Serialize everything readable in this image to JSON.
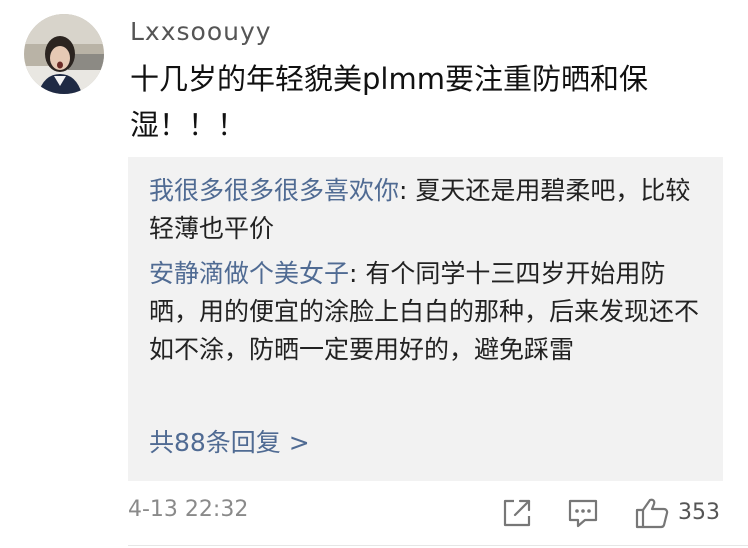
{
  "comment": {
    "username": "Lxxsoouyy",
    "text": "十几岁的年轻貌美plmm要注重防晒和保湿！！！",
    "timestamp": "4-13 22:32",
    "like_count": "353"
  },
  "replies": [
    {
      "user": "我很多很多很多喜欢你",
      "separator": ": ",
      "text": "夏天还是用碧柔吧，比较轻薄也平价"
    },
    {
      "user": "安静滴做个美女子",
      "separator": ": ",
      "text": "有个同学十三四岁开始用防晒，用的便宜的涂脸上白白的那种，后来发现还不如不涂，防晒一定要用好的，避免踩雷"
    }
  ],
  "more_replies_label": "共88条回复 >",
  "icons": {
    "share": "share-icon",
    "comment": "comment-icon",
    "like": "thumbs-up-icon"
  },
  "colors": {
    "username": "#555555",
    "reply_user": "#506b93",
    "reply_background": "#f2f2f2",
    "muted": "#8a8a8a"
  }
}
